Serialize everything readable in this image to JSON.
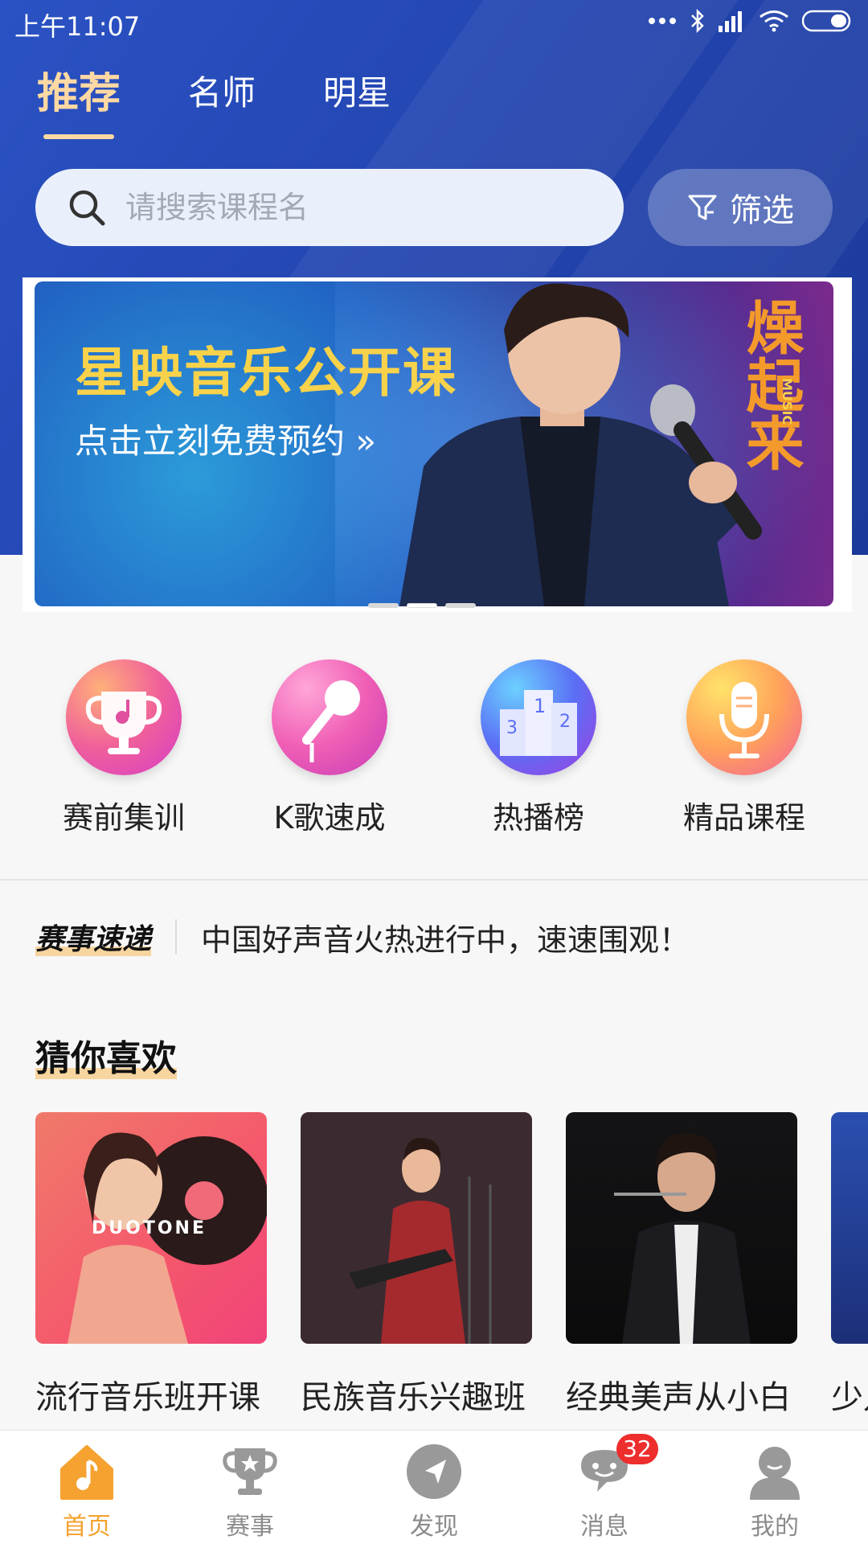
{
  "status_bar": {
    "time": "上午11:07"
  },
  "top_tabs": [
    {
      "label": "推荐",
      "active": true
    },
    {
      "label": "名师",
      "active": false
    },
    {
      "label": "明星",
      "active": false
    }
  ],
  "search": {
    "placeholder": "请搜索课程名",
    "filter_label": "筛选"
  },
  "banner": {
    "title": "星映音乐公开课",
    "subtitle": "点击立刻免费预约 »",
    "tag": "燥起来",
    "tag_small": "MUSIC",
    "pages": 3,
    "active_page": 2
  },
  "quick_entries": [
    {
      "label": "赛前集训",
      "icon": "trophy-music-icon"
    },
    {
      "label": "K歌速成",
      "icon": "microphone-icon"
    },
    {
      "label": "热播榜",
      "icon": "podium-icon"
    },
    {
      "label": "精品课程",
      "icon": "studio-mic-icon"
    }
  ],
  "news": {
    "tag": "赛事速递",
    "text": "中国好声音火热进行中，速速围观！"
  },
  "recommend": {
    "title": "猜你喜欢",
    "cards": [
      {
        "title": "流行音乐班开课",
        "art_text": "DUOTONE"
      },
      {
        "title": "民族音乐兴趣班"
      },
      {
        "title": "经典美声从小白"
      },
      {
        "title": "少儿"
      }
    ]
  },
  "tabbar": [
    {
      "label": "首页",
      "icon": "home-music-icon",
      "active": true
    },
    {
      "label": "赛事",
      "icon": "trophy-icon",
      "active": false
    },
    {
      "label": "发现",
      "icon": "compass-icon",
      "active": false
    },
    {
      "label": "消息",
      "icon": "chat-icon",
      "active": false,
      "badge": "32"
    },
    {
      "label": "我的",
      "icon": "user-icon",
      "active": false
    }
  ],
  "colors": {
    "brand_blue": "#2447b3",
    "accent_orange": "#f5a230",
    "badge_red": "#ee2d2d",
    "tab_active": "#ffd9a3"
  }
}
